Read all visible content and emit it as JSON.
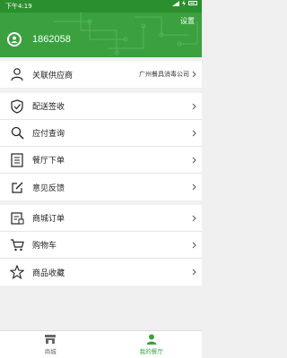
{
  "status_bar": {
    "time": "下午4:19"
  },
  "header": {
    "settings_label": "设置",
    "phone": "1862058"
  },
  "supplier": {
    "label": "关联供应商",
    "value": "广州餐具消毒公司"
  },
  "menu_group1": [
    {
      "label": "配送签收",
      "icon": "shield-check-icon"
    },
    {
      "label": "应付查询",
      "icon": "search-icon"
    },
    {
      "label": "餐厅下单",
      "icon": "document-list-icon"
    },
    {
      "label": "意见反馈",
      "icon": "edit-icon"
    }
  ],
  "menu_group2": [
    {
      "label": "商城订单",
      "icon": "order-icon"
    },
    {
      "label": "购物车",
      "icon": "cart-icon"
    },
    {
      "label": "商品收藏",
      "icon": "star-icon"
    }
  ],
  "tabbar": {
    "shop_label": "商城",
    "mine_label": "我的餐厅"
  },
  "colors": {
    "brand_green": "#3aa13e",
    "status_green": "#2a8f2d"
  }
}
